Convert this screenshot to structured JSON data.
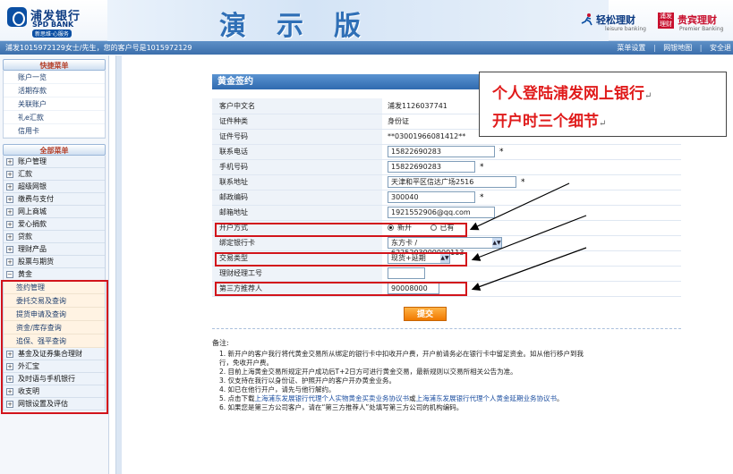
{
  "header": {
    "logo_cn": "浦发银行",
    "logo_en": "SPD BANK",
    "logo_slogan": "新思维·心服务",
    "banner_text": "演示版",
    "brand1_cn": "轻松理财",
    "brand1_en": "leisure banking",
    "brand2_cn": "贵宾理财",
    "brand2_box": "浦发 理财",
    "brand2_en": "Premier Banking"
  },
  "statusbar": {
    "welcome": "浦发1015972129女士/先生，您的客户号是1015972129",
    "links": [
      "菜单设置",
      "网银地图",
      "安全退"
    ]
  },
  "sidebar": {
    "quick_title": "快捷菜单",
    "quick_items": [
      "账户一览",
      "活期存款",
      "关联账户",
      "礼e汇款",
      "信用卡"
    ],
    "all_title": "全部菜单",
    "menu_top": [
      "账户管理",
      "汇款",
      "超级网银",
      "缴费与支付",
      "网上商城",
      "爱心捐款",
      "贷款",
      "理财产品",
      "股票与期货"
    ],
    "gold": "黄金",
    "gold_subs": [
      "签约管理",
      "委托交易及查询",
      "提货申请及查询",
      "资金/库存查询",
      "追保、强平查询"
    ],
    "menu_bottom": [
      "基金及证券集合理财",
      "外汇宝",
      "及时语与手机银行",
      "收支明",
      "网银设置及评估"
    ]
  },
  "form": {
    "title": "黄金签约",
    "rows": {
      "name": {
        "label": "客户中文名",
        "value": "浦发1126037741"
      },
      "idtype": {
        "label": "证件种类",
        "value": "身份证"
      },
      "idno": {
        "label": "证件号码",
        "value": "**03001966081412**"
      },
      "phone": {
        "label": "联系电话",
        "value": "15822690283"
      },
      "mobile": {
        "label": "手机号码",
        "value": "15822690283"
      },
      "address": {
        "label": "联系地址",
        "value": "天津和平区信达广场2516"
      },
      "zip": {
        "label": "邮政编码",
        "value": "300040"
      },
      "email": {
        "label": "邮箱地址",
        "value": "1921552906@qq.com"
      },
      "open_method": {
        "label": "开户方式",
        "option_new": "新开",
        "option_existing": "已有"
      },
      "bind_card": {
        "label": "绑定银行卡",
        "value": "东方卡 / 6225203000000113"
      },
      "trade_type": {
        "label": "交易类型",
        "value": "现货+延期"
      },
      "manager_id": {
        "label": "理财经理工号",
        "value": ""
      },
      "referrer": {
        "label": "第三方推荐人",
        "value": "90008000"
      }
    },
    "required_mark": "*",
    "submit": "提交"
  },
  "notes": {
    "title": "备注:",
    "lines": [
      "1. 新开户的客户我行将代黄金交易所从绑定的银行卡中扣收开户费，开户前请务必在银行卡中留足资金。如从他行移户到我",
      "行，免收开户费。",
      "2. 目前上海黄金交易所规定开户成功后T+2日方可进行黄金交易，最新规则以交易所相关公告为准。",
      "3. 仅支持在我行以身份证、护照开户的客户开办黄金业务。",
      "4. 如已在他行开户，请先与他行解约。"
    ],
    "line5_prefix": "5. 点击下载",
    "line5_link1": "上海浦东发展银行代理个人实物黄金买卖业务协议书",
    "line5_mid": "或",
    "line5_link2": "上海浦东发展银行代理个人黄金延期业务协议书",
    "line5_suffix": "。",
    "line6": "6. 如果您是第三方公司客户，请在“第三方推荐人”处填写第三方公司的机构编码。"
  },
  "callout": {
    "line1": "个人登陆浦发网上银行",
    "line2": "开户时三个细节",
    "mark": "↵"
  },
  "colors": {
    "highlight_red": "#d2141b",
    "header_blue": "#2f6aaf",
    "callout_red": "#e01b1b"
  }
}
